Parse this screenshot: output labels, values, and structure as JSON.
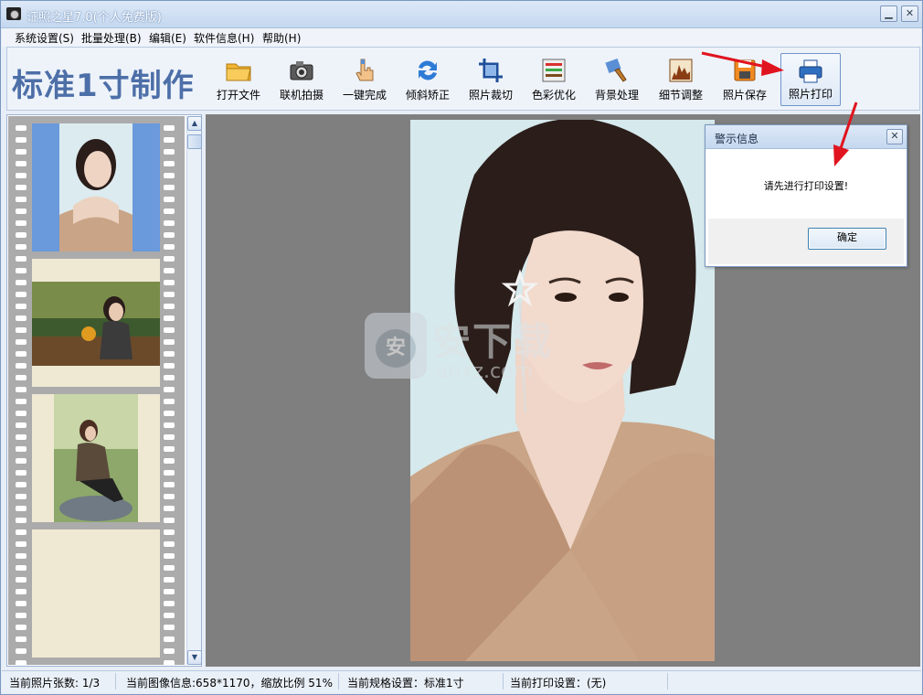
{
  "window": {
    "title": "证照之星7.0(个人免费版)",
    "minimize_icon": "minimize-icon",
    "close_icon": "close-icon"
  },
  "menu": [
    {
      "label": "系统设置(S)"
    },
    {
      "label": "批量处理(B)"
    },
    {
      "label": "编辑(E)"
    },
    {
      "label": "软件信息(H)"
    },
    {
      "label": "帮助(H)"
    }
  ],
  "brand": {
    "text": "标准1寸制作"
  },
  "toolbar": [
    {
      "label": "打开文件",
      "icon": "folder-icon"
    },
    {
      "label": "联机拍摄",
      "icon": "camera-icon"
    },
    {
      "label": "一键完成",
      "icon": "hand-pointer-icon"
    },
    {
      "label": "倾斜矫正",
      "icon": "rotate-icon"
    },
    {
      "label": "照片裁切",
      "icon": "crop-icon"
    },
    {
      "label": "色彩优化",
      "icon": "color-bars-icon"
    },
    {
      "label": "背景处理",
      "icon": "brush-icon"
    },
    {
      "label": "细节调整",
      "icon": "histogram-icon"
    },
    {
      "label": "照片保存",
      "icon": "save-icon"
    },
    {
      "label": "照片打印",
      "icon": "printer-icon"
    }
  ],
  "thumbnails": [
    {
      "name": "thumbnail-1",
      "selected": true
    },
    {
      "name": "thumbnail-2",
      "selected": false
    },
    {
      "name": "thumbnail-3",
      "selected": false
    },
    {
      "name": "thumbnail-4-empty",
      "selected": false
    }
  ],
  "watermark": {
    "text": "安下载",
    "domain": "anxz.com",
    "badge": "安"
  },
  "dialog": {
    "title": "警示信息",
    "message": "请先进行打印设置!",
    "ok_label": "确定"
  },
  "status": {
    "count": "当前照片张数: 1/3",
    "image_info": "当前图像信息:658*1170，缩放比例 51%",
    "spec": "当前规格设置：标准1寸",
    "print": "当前打印设置：(无)"
  },
  "colors": {
    "annotation_arrow": "#e0141e",
    "brand": "#4d6fa8",
    "canvas": "#7f7f7f"
  }
}
